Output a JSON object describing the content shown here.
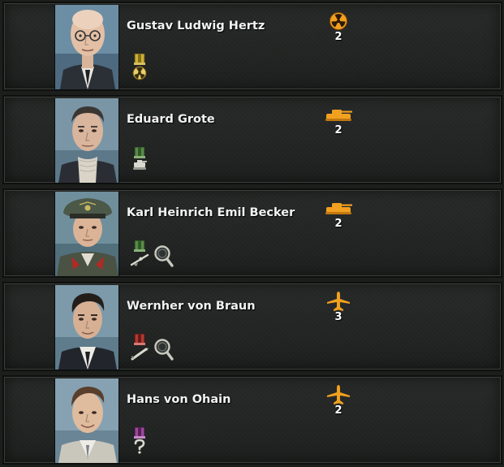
{
  "scientists": [
    {
      "name": "Gustav Ludwig Hertz",
      "specialization_icon": "nuclear-icon",
      "level": "2",
      "traits": [
        "gold-medal-nuclear-trait-icon"
      ]
    },
    {
      "name": "Eduard Grote",
      "specialization_icon": "tank-icon",
      "level": "2",
      "traits": [
        "green-medal-tank-trait-icon"
      ]
    },
    {
      "name": "Karl Heinrich Emil Becker",
      "specialization_icon": "tank-icon",
      "level": "2",
      "traits": [
        "green-medal-rifle-trait-icon",
        "magnifier-trait-icon"
      ]
    },
    {
      "name": "Wernher von Braun",
      "specialization_icon": "airplane-icon",
      "level": "3",
      "traits": [
        "red-medal-rocket-trait-icon",
        "magnifier-trait-icon"
      ]
    },
    {
      "name": "Hans von Ohain",
      "specialization_icon": "airplane-icon",
      "level": "2",
      "traits": [
        "purple-medal-unknown-trait-icon"
      ]
    }
  ],
  "colors": {
    "accent_orange": "#f2a020",
    "text": "#f2f2f2",
    "card_bg": "#222523"
  }
}
